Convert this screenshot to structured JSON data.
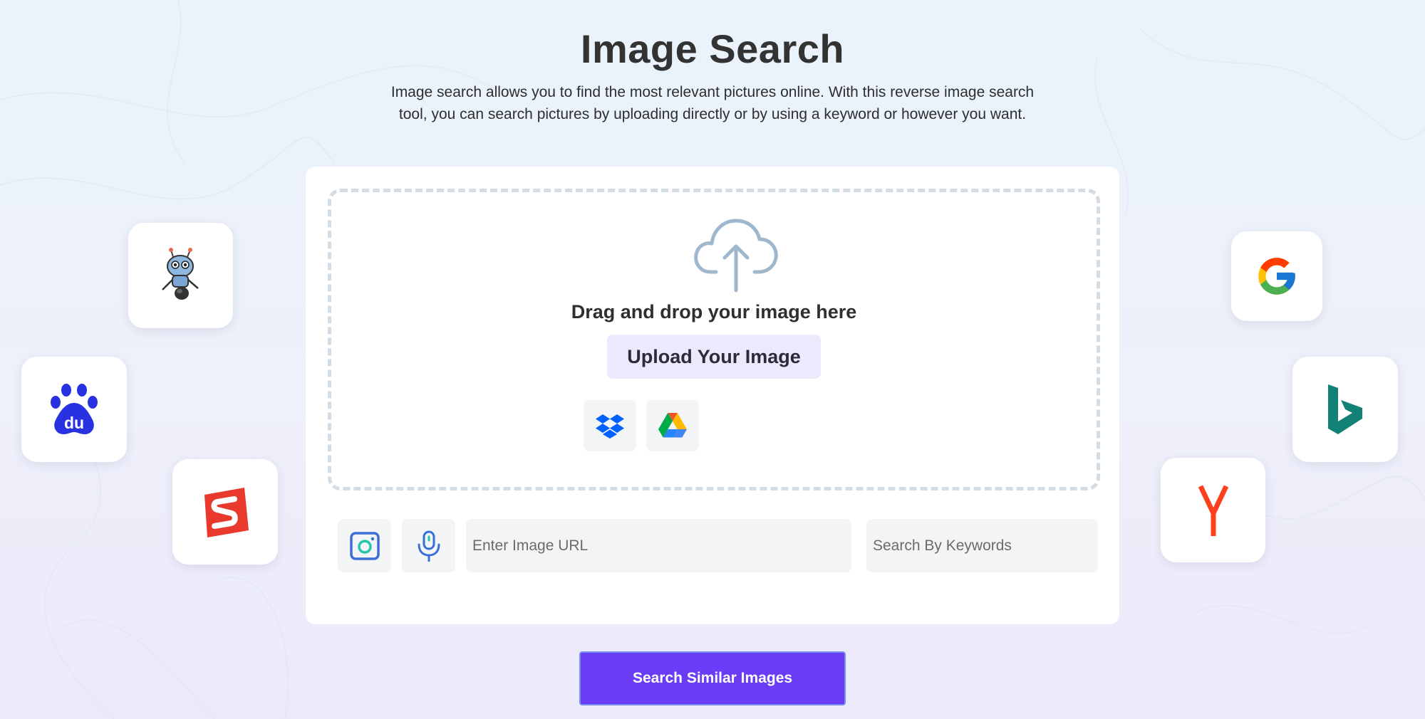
{
  "page": {
    "title": "Image Search",
    "description": "Image search allows you to find the most relevant pictures online. With this reverse image search tool, you can search pictures by uploading directly or by using a keyword or however you want."
  },
  "upload": {
    "drop_text": "Drag and drop your image here",
    "upload_button_label": "Upload Your Image",
    "sources": [
      {
        "icon": "dropbox-icon"
      },
      {
        "icon": "google-drive-icon"
      }
    ]
  },
  "inputs": {
    "camera_icon": "camera-icon",
    "mic_icon": "microphone-icon",
    "url_placeholder": "Enter Image URL",
    "url_value": "",
    "keywords_placeholder": "Search By Keywords",
    "keywords_value": ""
  },
  "search_button_label": "Search Similar Images",
  "engines": {
    "left": [
      {
        "name": "robot-mascot",
        "icon": "robot-icon"
      },
      {
        "name": "baidu",
        "icon": "baidu-icon",
        "logo_text": "du"
      },
      {
        "name": "sogou",
        "icon": "sogou-icon"
      }
    ],
    "right": [
      {
        "name": "google",
        "icon": "google-icon"
      },
      {
        "name": "bing",
        "icon": "bing-icon"
      },
      {
        "name": "yandex",
        "icon": "yandex-icon"
      }
    ]
  },
  "colors": {
    "accent": "#6a3cf6",
    "upload_button_bg": "#ebe9fc",
    "baidu_blue": "#2932e1",
    "sogou_red": "#e8392c",
    "bing_teal": "#138276",
    "yandex_red": "#fc3f1d"
  }
}
